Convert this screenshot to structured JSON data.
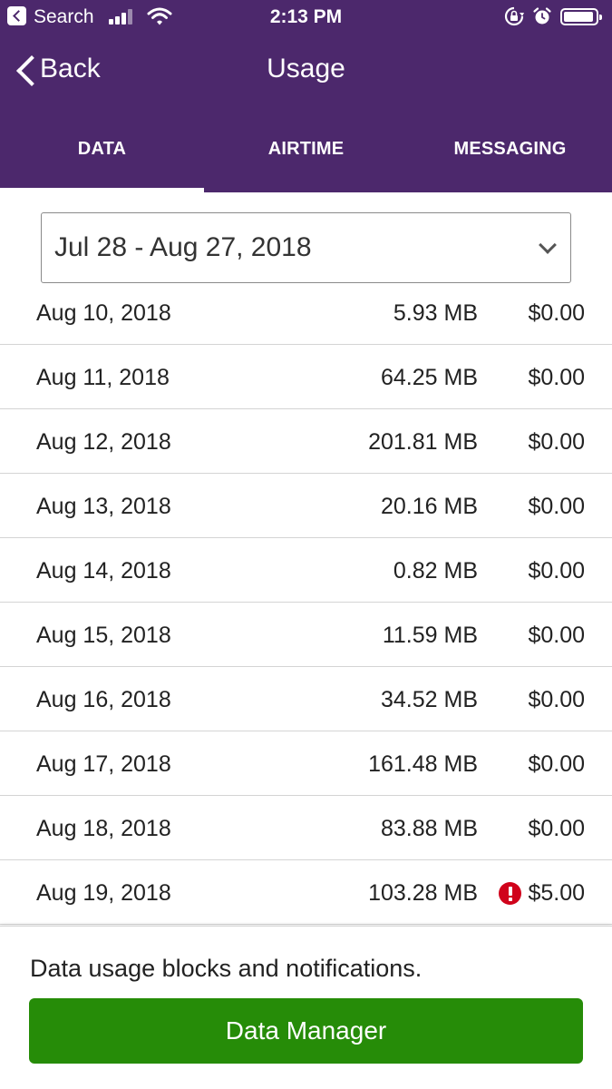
{
  "status_bar": {
    "back_app": "Search",
    "time": "2:13 PM",
    "icons": [
      "back-to-app-icon",
      "cellular-signal-icon",
      "wifi-icon",
      "orientation-lock-icon",
      "alarm-icon",
      "battery-icon"
    ]
  },
  "nav": {
    "back_label": "Back",
    "title": "Usage"
  },
  "tabs": [
    {
      "label": "DATA",
      "active": true
    },
    {
      "label": "AIRTIME",
      "active": false
    },
    {
      "label": "MESSAGING",
      "active": false
    }
  ],
  "period_select": {
    "value": "Jul 28 - Aug 27, 2018"
  },
  "usage_rows": [
    {
      "date": "Aug 10, 2018",
      "amount": "5.93 MB",
      "cost": "$0.00",
      "alert": false
    },
    {
      "date": "Aug 11, 2018",
      "amount": "64.25 MB",
      "cost": "$0.00",
      "alert": false
    },
    {
      "date": "Aug 12, 2018",
      "amount": "201.81 MB",
      "cost": "$0.00",
      "alert": false
    },
    {
      "date": "Aug 13, 2018",
      "amount": "20.16 MB",
      "cost": "$0.00",
      "alert": false
    },
    {
      "date": "Aug 14, 2018",
      "amount": "0.82 MB",
      "cost": "$0.00",
      "alert": false
    },
    {
      "date": "Aug 15, 2018",
      "amount": "11.59 MB",
      "cost": "$0.00",
      "alert": false
    },
    {
      "date": "Aug 16, 2018",
      "amount": "34.52 MB",
      "cost": "$0.00",
      "alert": false
    },
    {
      "date": "Aug 17, 2018",
      "amount": "161.48 MB",
      "cost": "$0.00",
      "alert": false
    },
    {
      "date": "Aug 18, 2018",
      "amount": "83.88 MB",
      "cost": "$0.00",
      "alert": false
    },
    {
      "date": "Aug 19, 2018",
      "amount": "103.28 MB",
      "cost": "$5.00",
      "alert": true
    }
  ],
  "footer": {
    "description": "Data usage blocks and notifications.",
    "button_label": "Data Manager"
  },
  "colors": {
    "header_bg": "#4c286c",
    "button_bg": "#268c08",
    "alert": "#d0021b"
  }
}
